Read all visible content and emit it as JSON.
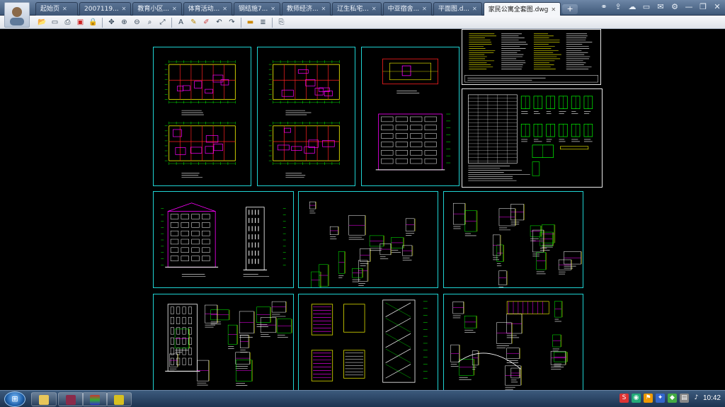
{
  "window": {
    "tabs": [
      {
        "label": "起始页",
        "active": false
      },
      {
        "label": "2007119...",
        "active": false
      },
      {
        "label": "教育小区...",
        "active": false
      },
      {
        "label": "体育活动...",
        "active": false
      },
      {
        "label": "钢结施7...",
        "active": false
      },
      {
        "label": "教师经济...",
        "active": false
      },
      {
        "label": "辽生私宅...",
        "active": false
      },
      {
        "label": "中亚宿舍...",
        "active": false
      },
      {
        "label": "平面图.d...",
        "active": false
      },
      {
        "label": "家民公寓全套图.dwg",
        "active": true
      }
    ],
    "new_tab_label": "+",
    "close_glyph": "✕"
  },
  "toolbar": {
    "buttons": [
      "open-icon",
      "save-icon",
      "print-icon",
      "pdf-icon",
      "lock-icon",
      "pan-icon",
      "zoom-in-icon",
      "zoom-out-icon",
      "zoom-window-icon",
      "zoom-extents-icon",
      "text-icon",
      "pen-icon",
      "eraser-icon",
      "undo-icon",
      "redo-icon",
      "measure-icon",
      "layers-icon",
      "export-icon"
    ]
  },
  "drawing": {
    "file": "家民公寓全套图.dwg",
    "colors": {
      "background": "#000000",
      "frame": "#1fd3d3",
      "frame_white": "#e8e8e8",
      "yellow": "#ffff00",
      "magenta": "#ff00ff",
      "green": "#00ff00",
      "cyan": "#00ffff",
      "red": "#ff2020",
      "white": "#ffffff"
    }
  },
  "taskbar": {
    "clock": "10:42",
    "start_label": "⊞",
    "tray": [
      "S",
      "◉",
      "⚑",
      "✦",
      "◆",
      "▤",
      "♪"
    ]
  }
}
